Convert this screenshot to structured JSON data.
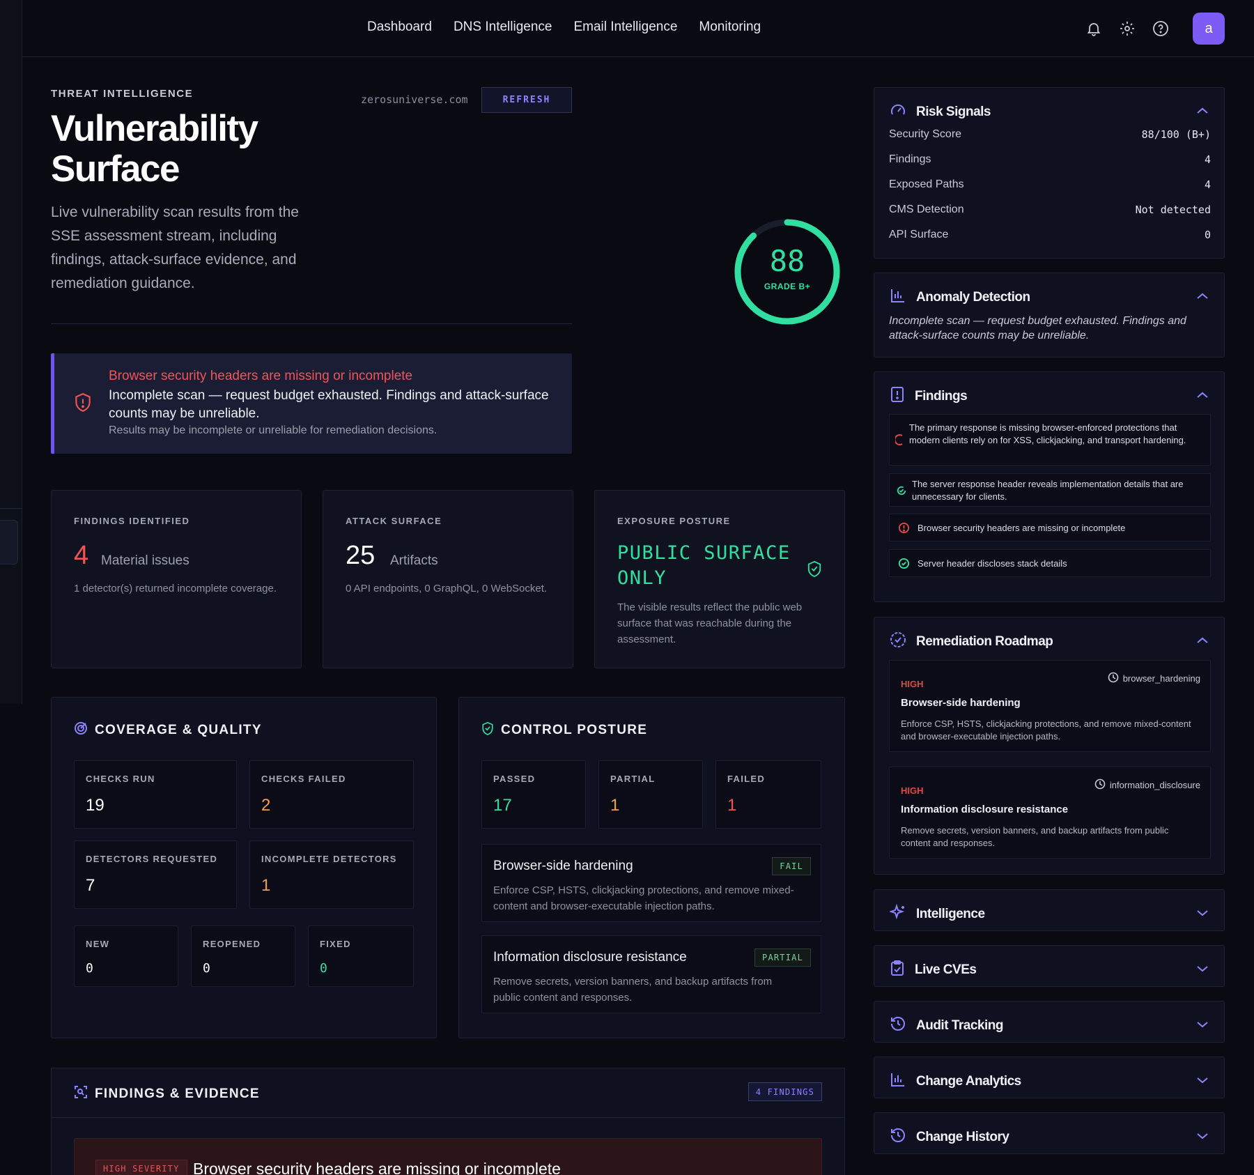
{
  "nav": {
    "items": [
      "Dashboard",
      "DNS Intelligence",
      "Email Intelligence",
      "Monitoring"
    ]
  },
  "user": {
    "avatar_letter": "a"
  },
  "hero": {
    "eyebrow": "THREAT INTELLIGENCE",
    "title": "Vulnerability Surface",
    "description": "Live vulnerability scan results from the SSE assessment stream, including findings, attack-surface evidence, and remediation guidance.",
    "domain": "zerosuniverse.com",
    "refresh_label": "REFRESH"
  },
  "gauge": {
    "score": "88",
    "grade": "GRADE B+",
    "score_fraction": 0.88
  },
  "alert": {
    "title": "Browser security headers are missing or incomplete",
    "body": "Incomplete scan — request budget exhausted. Findings and attack-surface counts may be unreliable.",
    "note": "Results may be incomplete or unreliable for remediation decisions."
  },
  "stats": {
    "findings": {
      "label": "FINDINGS IDENTIFIED",
      "value": "4",
      "unit": "Material issues",
      "sub": "1 detector(s) returned incomplete coverage."
    },
    "attack": {
      "label": "ATTACK SURFACE",
      "value": "25",
      "unit": "Artifacts",
      "sub": "0 API endpoints, 0 GraphQL, 0 WebSocket."
    },
    "exposure": {
      "label": "EXPOSURE POSTURE",
      "value": "PUBLIC SURFACE ONLY",
      "desc": "The visible results reflect the public web surface that was reachable during the assessment."
    }
  },
  "coverage": {
    "title": "COVERAGE & QUALITY",
    "checks_run": {
      "label": "CHECKS RUN",
      "value": "19"
    },
    "checks_failed": {
      "label": "CHECKS FAILED",
      "value": "2"
    },
    "detectors_requested": {
      "label": "DETECTORS REQUESTED",
      "value": "7"
    },
    "incomplete_detectors": {
      "label": "INCOMPLETE DETECTORS",
      "value": "1"
    },
    "new": {
      "label": "NEW",
      "value": "0"
    },
    "reopened": {
      "label": "REOPENED",
      "value": "0"
    },
    "fixed": {
      "label": "FIXED",
      "value": "0"
    }
  },
  "control": {
    "title": "CONTROL POSTURE",
    "passed": {
      "label": "PASSED",
      "value": "17"
    },
    "partial": {
      "label": "PARTIAL",
      "value": "1"
    },
    "failed": {
      "label": "FAILED",
      "value": "1"
    },
    "items": [
      {
        "title": "Browser-side hardening",
        "badge": "FAIL",
        "desc": "Enforce CSP, HSTS, clickjacking protections, and remove mixed-content and browser-executable injection paths."
      },
      {
        "title": "Information disclosure resistance",
        "badge": "PARTIAL",
        "desc": "Remove secrets, version banners, and backup artifacts from public content and responses."
      }
    ]
  },
  "evidence": {
    "title": "FINDINGS & EVIDENCE",
    "badge": "4 FINDINGS",
    "first": {
      "severity": "HIGH SEVERITY",
      "title": "Browser security headers are missing or incomplete"
    }
  },
  "risk": {
    "title": "Risk Signals",
    "rows": [
      {
        "label": "Security Score",
        "value": "88/100 (B+)"
      },
      {
        "label": "Findings",
        "value": "4"
      },
      {
        "label": "Exposed Paths",
        "value": "4"
      },
      {
        "label": "CMS Detection",
        "value": "Not detected"
      },
      {
        "label": "API Surface",
        "value": "0"
      }
    ]
  },
  "anomaly": {
    "title": "Anomaly Detection",
    "text": "Incomplete scan — request budget exhausted. Findings and attack-surface counts may be unreliable."
  },
  "findings_panel": {
    "title": "Findings",
    "items": [
      "The primary response is missing browser-enforced protections that modern clients rely on for XSS, clickjacking, and transport hardening.",
      "The server response header reveals implementation details that are unnecessary for clients.",
      "Browser security headers are missing or incomplete",
      "Server header discloses stack details"
    ]
  },
  "roadmap": {
    "title": "Remediation Roadmap",
    "items": [
      {
        "priority": "HIGH",
        "tag": "browser_hardening",
        "title": "Browser-side hardening",
        "desc": "Enforce CSP, HSTS, clickjacking protections, and remove mixed-content and browser-executable injection paths."
      },
      {
        "priority": "HIGH",
        "tag": "information_disclosure",
        "title": "Information disclosure resistance",
        "desc": "Remove secrets, version banners, and backup artifacts from public content and responses."
      }
    ]
  },
  "collapsed": {
    "intelligence": "Intelligence",
    "live_cves": "Live CVEs",
    "audit": "Audit Tracking",
    "change_analytics": "Change Analytics",
    "change_history": "Change History"
  },
  "colors": {
    "accent": "#7c5cf5",
    "success": "#31e0a0",
    "danger": "#e04848",
    "warning": "#f0a04b"
  }
}
